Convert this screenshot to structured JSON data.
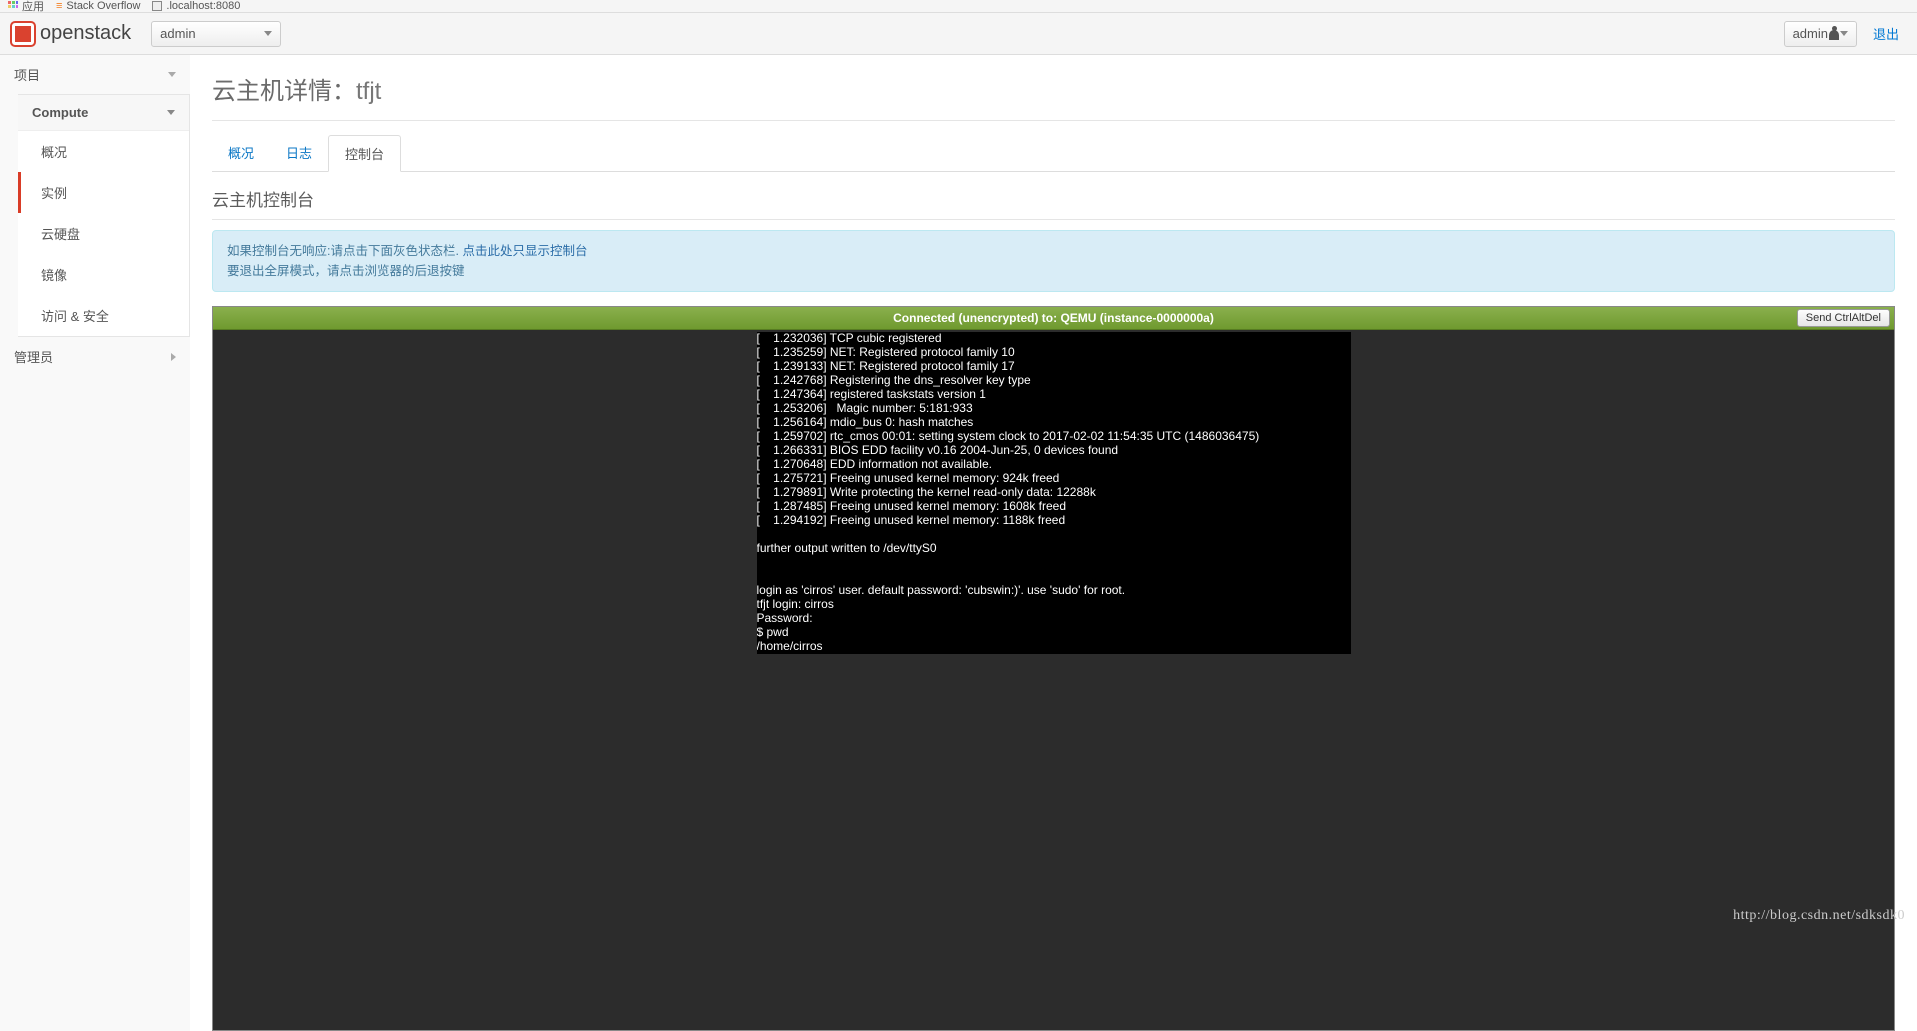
{
  "browser": {
    "apps_label": "应用",
    "bookmarks": [
      {
        "label": "Stack Overflow"
      },
      {
        "label": ".localhost:8080"
      }
    ]
  },
  "header": {
    "brand": "openstack",
    "project_selected": "admin",
    "user_label": "admin",
    "logout_label": "退出"
  },
  "sidebar": {
    "project_label": "项目",
    "compute_label": "Compute",
    "items": [
      {
        "label": "概况"
      },
      {
        "label": "实例"
      },
      {
        "label": "云硬盘"
      },
      {
        "label": "镜像"
      },
      {
        "label": "访问 & 安全"
      }
    ],
    "admin_label": "管理员"
  },
  "page": {
    "title_prefix": "云主机详情：",
    "instance_name": "tfjt",
    "tabs": [
      {
        "label": "概况"
      },
      {
        "label": "日志"
      },
      {
        "label": "控制台"
      }
    ],
    "section_title": "云主机控制台",
    "info_line1_a": "如果控制台无响应:请点击下面灰色状态栏.",
    "info_link": "点击此处只显示控制台",
    "info_line2": "要退出全屏模式，请点击浏览器的后退按键"
  },
  "vnc": {
    "status": "Connected (unencrypted) to: QEMU (instance-0000000a)",
    "button_label": "Send CtrlAltDel",
    "terminal_text": "[    1.232036] TCP cubic registered\n[    1.235259] NET: Registered protocol family 10\n[    1.239133] NET: Registered protocol family 17\n[    1.242768] Registering the dns_resolver key type\n[    1.247364] registered taskstats version 1\n[    1.253206]   Magic number: 5:181:933\n[    1.256164] mdio_bus 0: hash matches\n[    1.259702] rtc_cmos 00:01: setting system clock to 2017-02-02 11:54:35 UTC (1486036475)\n[    1.266331] BIOS EDD facility v0.16 2004-Jun-25, 0 devices found\n[    1.270648] EDD information not available.\n[    1.275721] Freeing unused kernel memory: 924k freed\n[    1.279891] Write protecting the kernel read-only data: 12288k\n[    1.287485] Freeing unused kernel memory: 1608k freed\n[    1.294192] Freeing unused kernel memory: 1188k freed\n\nfurther output written to /dev/ttyS0\n\n\nlogin as 'cirros' user. default password: 'cubswin:)'. use 'sudo' for root.\ntfjt login: cirros\nPassword:\n$ pwd\n/home/cirros\n$ "
  },
  "watermark": "http://blog.csdn.net/sdksdk0"
}
